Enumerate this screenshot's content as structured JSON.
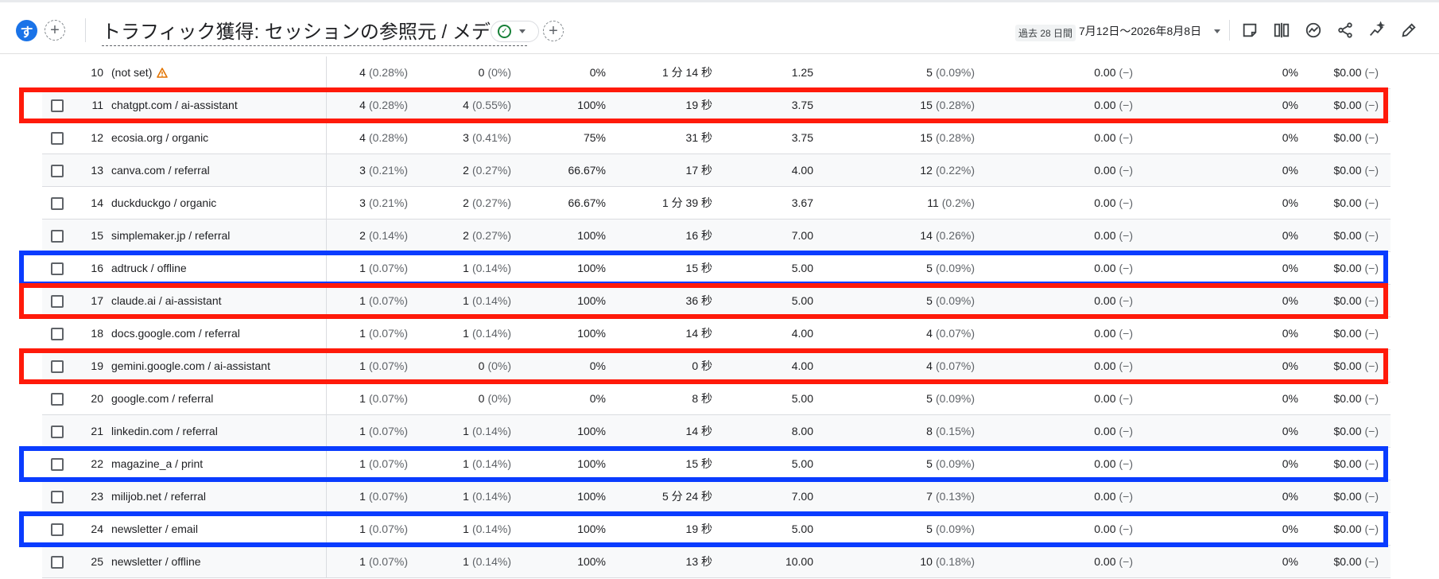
{
  "header": {
    "avatar_letter": "す",
    "title": "トラフィック獲得: セッションの参照元 / メディア",
    "add_label": "+",
    "date_label": "過去 28 日間",
    "date_range": "7月12日〜2026年8月8日"
  },
  "icons": {
    "status": "check-circle-icon",
    "tools": [
      "insights-note-icon",
      "compare-icon",
      "trend-icon",
      "share-icon",
      "sparkle-icon",
      "edit-icon"
    ]
  },
  "colors": {
    "accent": "#1a73e8",
    "success": "#188038",
    "highlight_red": "#ff1a0a",
    "highlight_blue": "#0a3cff"
  },
  "rows": [
    {
      "idx": "10",
      "dim": "(not set)",
      "warn": true,
      "checkbox": false,
      "c1": "4",
      "c1p": "(0.28%)",
      "c2": "0",
      "c2p": "(0%)",
      "c3": "0%",
      "c4": "1 分 14 秒",
      "c5": "1.25",
      "c6": "5",
      "c6p": "(0.09%)",
      "c7": "0.00",
      "c7p": "(−)",
      "c8": "0%",
      "c9": "$0.00",
      "c9p": "(−)",
      "highlight": ""
    },
    {
      "idx": "11",
      "dim": "chatgpt.com / ai-assistant",
      "warn": false,
      "checkbox": true,
      "c1": "4",
      "c1p": "(0.28%)",
      "c2": "4",
      "c2p": "(0.55%)",
      "c3": "100%",
      "c4": "19 秒",
      "c5": "3.75",
      "c6": "15",
      "c6p": "(0.28%)",
      "c7": "0.00",
      "c7p": "(−)",
      "c8": "0%",
      "c9": "$0.00",
      "c9p": "(−)",
      "highlight": "red"
    },
    {
      "idx": "12",
      "dim": "ecosia.org / organic",
      "warn": false,
      "checkbox": true,
      "c1": "4",
      "c1p": "(0.28%)",
      "c2": "3",
      "c2p": "(0.41%)",
      "c3": "75%",
      "c4": "31 秒",
      "c5": "3.75",
      "c6": "15",
      "c6p": "(0.28%)",
      "c7": "0.00",
      "c7p": "(−)",
      "c8": "0%",
      "c9": "$0.00",
      "c9p": "(−)",
      "highlight": ""
    },
    {
      "idx": "13",
      "dim": "canva.com / referral",
      "warn": false,
      "checkbox": true,
      "c1": "3",
      "c1p": "(0.21%)",
      "c2": "2",
      "c2p": "(0.27%)",
      "c3": "66.67%",
      "c4": "17 秒",
      "c5": "4.00",
      "c6": "12",
      "c6p": "(0.22%)",
      "c7": "0.00",
      "c7p": "(−)",
      "c8": "0%",
      "c9": "$0.00",
      "c9p": "(−)",
      "highlight": ""
    },
    {
      "idx": "14",
      "dim": "duckduckgo / organic",
      "warn": false,
      "checkbox": true,
      "c1": "3",
      "c1p": "(0.21%)",
      "c2": "2",
      "c2p": "(0.27%)",
      "c3": "66.67%",
      "c4": "1 分 39 秒",
      "c5": "3.67",
      "c6": "11",
      "c6p": "(0.2%)",
      "c7": "0.00",
      "c7p": "(−)",
      "c8": "0%",
      "c9": "$0.00",
      "c9p": "(−)",
      "highlight": ""
    },
    {
      "idx": "15",
      "dim": "simplemaker.jp / referral",
      "warn": false,
      "checkbox": true,
      "c1": "2",
      "c1p": "(0.14%)",
      "c2": "2",
      "c2p": "(0.27%)",
      "c3": "100%",
      "c4": "16 秒",
      "c5": "7.00",
      "c6": "14",
      "c6p": "(0.26%)",
      "c7": "0.00",
      "c7p": "(−)",
      "c8": "0%",
      "c9": "$0.00",
      "c9p": "(−)",
      "highlight": ""
    },
    {
      "idx": "16",
      "dim": "adtruck / offline",
      "warn": false,
      "checkbox": true,
      "c1": "1",
      "c1p": "(0.07%)",
      "c2": "1",
      "c2p": "(0.14%)",
      "c3": "100%",
      "c4": "15 秒",
      "c5": "5.00",
      "c6": "5",
      "c6p": "(0.09%)",
      "c7": "0.00",
      "c7p": "(−)",
      "c8": "0%",
      "c9": "$0.00",
      "c9p": "(−)",
      "highlight": "blue"
    },
    {
      "idx": "17",
      "dim": "claude.ai / ai-assistant",
      "warn": false,
      "checkbox": true,
      "c1": "1",
      "c1p": "(0.07%)",
      "c2": "1",
      "c2p": "(0.14%)",
      "c3": "100%",
      "c4": "36 秒",
      "c5": "5.00",
      "c6": "5",
      "c6p": "(0.09%)",
      "c7": "0.00",
      "c7p": "(−)",
      "c8": "0%",
      "c9": "$0.00",
      "c9p": "(−)",
      "highlight": "red"
    },
    {
      "idx": "18",
      "dim": "docs.google.com / referral",
      "warn": false,
      "checkbox": true,
      "c1": "1",
      "c1p": "(0.07%)",
      "c2": "1",
      "c2p": "(0.14%)",
      "c3": "100%",
      "c4": "14 秒",
      "c5": "4.00",
      "c6": "4",
      "c6p": "(0.07%)",
      "c7": "0.00",
      "c7p": "(−)",
      "c8": "0%",
      "c9": "$0.00",
      "c9p": "(−)",
      "highlight": ""
    },
    {
      "idx": "19",
      "dim": "gemini.google.com / ai-assistant",
      "warn": false,
      "checkbox": true,
      "c1": "1",
      "c1p": "(0.07%)",
      "c2": "0",
      "c2p": "(0%)",
      "c3": "0%",
      "c4": "0 秒",
      "c5": "4.00",
      "c6": "4",
      "c6p": "(0.07%)",
      "c7": "0.00",
      "c7p": "(−)",
      "c8": "0%",
      "c9": "$0.00",
      "c9p": "(−)",
      "highlight": "red"
    },
    {
      "idx": "20",
      "dim": "google.com / referral",
      "warn": false,
      "checkbox": true,
      "c1": "1",
      "c1p": "(0.07%)",
      "c2": "0",
      "c2p": "(0%)",
      "c3": "0%",
      "c4": "8 秒",
      "c5": "5.00",
      "c6": "5",
      "c6p": "(0.09%)",
      "c7": "0.00",
      "c7p": "(−)",
      "c8": "0%",
      "c9": "$0.00",
      "c9p": "(−)",
      "highlight": ""
    },
    {
      "idx": "21",
      "dim": "linkedin.com / referral",
      "warn": false,
      "checkbox": true,
      "c1": "1",
      "c1p": "(0.07%)",
      "c2": "1",
      "c2p": "(0.14%)",
      "c3": "100%",
      "c4": "14 秒",
      "c5": "8.00",
      "c6": "8",
      "c6p": "(0.15%)",
      "c7": "0.00",
      "c7p": "(−)",
      "c8": "0%",
      "c9": "$0.00",
      "c9p": "(−)",
      "highlight": ""
    },
    {
      "idx": "22",
      "dim": "magazine_a / print",
      "warn": false,
      "checkbox": true,
      "c1": "1",
      "c1p": "(0.07%)",
      "c2": "1",
      "c2p": "(0.14%)",
      "c3": "100%",
      "c4": "15 秒",
      "c5": "5.00",
      "c6": "5",
      "c6p": "(0.09%)",
      "c7": "0.00",
      "c7p": "(−)",
      "c8": "0%",
      "c9": "$0.00",
      "c9p": "(−)",
      "highlight": "blue"
    },
    {
      "idx": "23",
      "dim": "milijob.net / referral",
      "warn": false,
      "checkbox": true,
      "c1": "1",
      "c1p": "(0.07%)",
      "c2": "1",
      "c2p": "(0.14%)",
      "c3": "100%",
      "c4": "5 分 24 秒",
      "c5": "7.00",
      "c6": "7",
      "c6p": "(0.13%)",
      "c7": "0.00",
      "c7p": "(−)",
      "c8": "0%",
      "c9": "$0.00",
      "c9p": "(−)",
      "highlight": ""
    },
    {
      "idx": "24",
      "dim": "newsletter / email",
      "warn": false,
      "checkbox": true,
      "c1": "1",
      "c1p": "(0.07%)",
      "c2": "1",
      "c2p": "(0.14%)",
      "c3": "100%",
      "c4": "19 秒",
      "c5": "5.00",
      "c6": "5",
      "c6p": "(0.09%)",
      "c7": "0.00",
      "c7p": "(−)",
      "c8": "0%",
      "c9": "$0.00",
      "c9p": "(−)",
      "highlight": "blue"
    },
    {
      "idx": "25",
      "dim": "newsletter / offline",
      "warn": false,
      "checkbox": true,
      "c1": "1",
      "c1p": "(0.07%)",
      "c2": "1",
      "c2p": "(0.14%)",
      "c3": "100%",
      "c4": "13 秒",
      "c5": "10.00",
      "c6": "10",
      "c6p": "(0.18%)",
      "c7": "0.00",
      "c7p": "(−)",
      "c8": "0%",
      "c9": "$0.00",
      "c9p": "(−)",
      "highlight": ""
    }
  ]
}
